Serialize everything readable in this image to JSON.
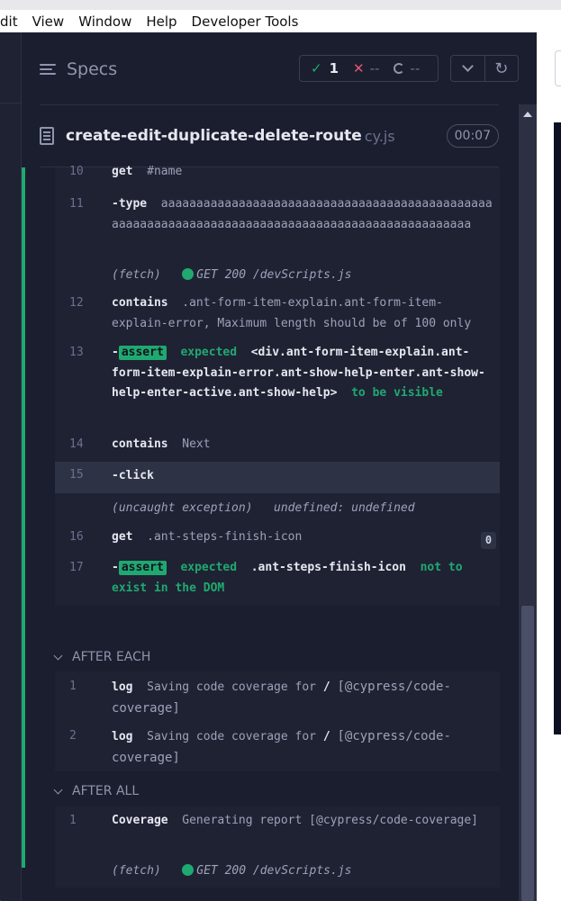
{
  "menubar": [
    "dit",
    "View",
    "Window",
    "Help",
    "Developer Tools"
  ],
  "header": {
    "specs_label": "Specs",
    "passed": "1",
    "failed": "--",
    "pending": "--"
  },
  "spec": {
    "name": "create-edit-duplicate-delete-route",
    "ext": "cy.js",
    "duration": "00:07"
  },
  "commands": [
    {
      "num": "10",
      "name": "get",
      "msg": "#name"
    },
    {
      "num": "11",
      "name": "type",
      "msg": "aaaaaaaaaaaaaaaaaaaaaaaaaaaaaaaaaaaaaaaaaaaaaaaaaaaaaaaaaaaaaaaaaaaaaaaaaaaaaaaaaaaaaaaaaaaaaaaaaa"
    },
    {
      "fetch_label": "(fetch)",
      "fetch_msg": "GET 200 /devScripts.js"
    },
    {
      "num": "12",
      "name": "contains",
      "msg": ".ant-form-item-explain.ant-form-item-explain-error, Maximum length should be of 100 only"
    },
    {
      "num": "13",
      "name": "assert",
      "expected": "expected",
      "subject": "<div.ant-form-item-explain.ant-form-item-explain-error.ant-show-help-enter.ant-show-help-enter-active.ant-show-help>",
      "tail": "to be",
      "tail2": "visible"
    },
    {
      "num": "14",
      "name": "contains",
      "msg": "Next"
    },
    {
      "num": "15",
      "name": "click"
    },
    {
      "label": "(uncaught exception)",
      "msg": "undefined: undefined"
    },
    {
      "num": "16",
      "name": "get",
      "msg": ".ant-steps-finish-icon",
      "count": "0"
    },
    {
      "num": "17",
      "name": "assert",
      "expected": "expected",
      "subject": ".ant-steps-finish-icon",
      "tail": "not to",
      "tail2": "exist in the DOM"
    }
  ],
  "after_each": {
    "title": "AFTER EACH",
    "items": [
      {
        "num": "1",
        "name": "log",
        "msg1": "Saving code coverage for",
        "slash": "/",
        "msg2": "[@cypress/code-coverage]"
      },
      {
        "num": "2",
        "name": "log",
        "msg1": "Saving code coverage for",
        "slash": "/",
        "msg2": "[@cypress/code-coverage]"
      }
    ]
  },
  "after_all": {
    "title": "AFTER ALL",
    "items": [
      {
        "num": "1",
        "name": "Coverage",
        "msg": "Generating report [@cypress/code-coverage]"
      },
      {
        "fetch_label": "(fetch)",
        "fetch_msg": "GET 200 /devScripts.js"
      }
    ]
  }
}
